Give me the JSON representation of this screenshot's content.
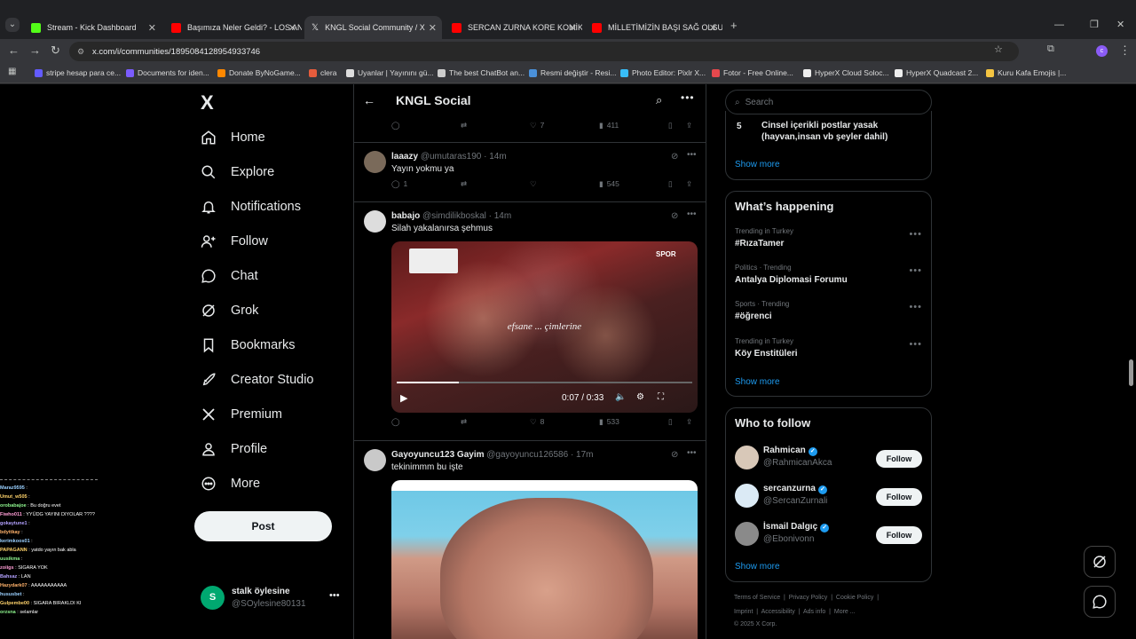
{
  "browser": {
    "tabs": [
      {
        "title": "Stream - Kick Dashboard",
        "color": "#53fc18"
      },
      {
        "title": "Başımıza Neler Geldi? - LOS AN",
        "color": "#ff0000"
      },
      {
        "title": "KNGL Social Community / X",
        "color": "#ffffff"
      },
      {
        "title": "SERCAN ZURNA KORE KOMİK",
        "color": "#ff0000"
      },
      {
        "title": "MİLLETİMİZİN BAŞI SAĞ OLSUN",
        "color": "#ff0000"
      }
    ],
    "url": "x.com/i/communities/1895084128954933746",
    "bookmarks": [
      "stripe hesap para ce...",
      "Documents for iden...",
      "Donate ByNoGame...",
      "clera",
      "Uyanlar | Yayınını gü...",
      "The best ChatBot an...",
      "Resmi değiştir - Resi...",
      "Photo Editor: Pixlr X...",
      "Fotor - Free Online...",
      "HyperX Cloud Soloc...",
      "HyperX Quadcast 2...",
      "Kuru Kafa Emojis |..."
    ]
  },
  "sidebar": {
    "logo": "X",
    "items": [
      {
        "label": "Home",
        "icon": "home-icon"
      },
      {
        "label": "Explore",
        "icon": "search-icon"
      },
      {
        "label": "Notifications",
        "icon": "bell-icon"
      },
      {
        "label": "Follow",
        "icon": "add-user-icon"
      },
      {
        "label": "Chat",
        "icon": "chat-icon"
      },
      {
        "label": "Grok",
        "icon": "grok-icon"
      },
      {
        "label": "Bookmarks",
        "icon": "bookmark-icon"
      },
      {
        "label": "Creator Studio",
        "icon": "rocket-icon"
      },
      {
        "label": "Premium",
        "icon": "x-icon"
      },
      {
        "label": "Profile",
        "icon": "person-icon"
      },
      {
        "label": "More",
        "icon": "more-circle-icon"
      }
    ],
    "post_label": "Post",
    "account": {
      "name": "stalk öylesine",
      "handle": "@SOylesine80131",
      "initial": "S"
    }
  },
  "header": {
    "title": "KNGL Social"
  },
  "feed": {
    "top_actions": {
      "likes": "7",
      "views": "411"
    },
    "posts": [
      {
        "name": "laaazy",
        "handle": "@umutaras190 · 14m",
        "text": "Yayın yokmu ya",
        "replies": "1",
        "likes": "",
        "views": "545"
      },
      {
        "name": "babajo",
        "handle": "@simdilikboskal · 14m",
        "text": "Silah yakalanırsa şehmus",
        "video_overlay": "efsane ... çimlerine",
        "video_time": "0:07 / 0:33",
        "watermark": "SPOR",
        "likes": "8",
        "views": "533"
      },
      {
        "name": "Gayoyuncu123 Gayim",
        "handle": "@gayoyuncu126586 · 17m",
        "text": "tekinimmm bu işte"
      }
    ]
  },
  "right": {
    "search_placeholder": "Search",
    "rule": {
      "num": "5",
      "text": "Cinsel içerikli postlar yasak (hayvan,insan vb şeyler dahil)"
    },
    "show_more": "Show more",
    "happening_title": "What’s happening",
    "trends": [
      {
        "meta": "Trending in Turkey",
        "name": "#RızaTamer"
      },
      {
        "meta": "Politics · Trending",
        "name": "Antalya Diplomasi Forumu"
      },
      {
        "meta": "Sports · Trending",
        "name": "#öğrenci"
      },
      {
        "meta": "Trending in Turkey",
        "name": "Köy Enstitüleri"
      }
    ],
    "who_title": "Who to follow",
    "follow_label": "Follow",
    "who": [
      {
        "name": "Rahmican",
        "handle": "@RahmicanAkca"
      },
      {
        "name": "sercanzurna",
        "handle": "@SercanZurnali"
      },
      {
        "name": "İsmail Dalgıç",
        "handle": "@Ebonivonn"
      }
    ],
    "footer": [
      "Terms of Service",
      "Privacy Policy",
      "Cookie Policy",
      "Imprint",
      "Accessibility",
      "Ads info",
      "More ...",
      "© 2025 X Corp."
    ]
  },
  "chat_overlay": [
    {
      "user": "Maraz9595",
      "msg": ""
    },
    {
      "user": "Umut_w505",
      "msg": ""
    },
    {
      "user": "orobabajoe",
      "msg": "Bu doğru evet"
    },
    {
      "user": "Fiwho011",
      "msg": "YYÜDG YAYINI DIYOLAR ????"
    },
    {
      "user": "gokaytune1",
      "msg": ""
    },
    {
      "user": "bdyttkay",
      "msg": ""
    },
    {
      "user": "kerimkoos01",
      "msg": ""
    },
    {
      "user": "PAPAGANN",
      "msg": "yatdo yayın bak abla"
    },
    {
      "user": "uusikma",
      "msg": ""
    },
    {
      "user": "zoiigs",
      "msg": "SIGARA YOK"
    },
    {
      "user": "Bahsaz",
      "msg": "LAN"
    },
    {
      "user": "Hazydark07",
      "msg": "AAAAAAAAAAA"
    },
    {
      "user": "hususbet",
      "msg": ""
    },
    {
      "user": "Gulpembe00",
      "msg": "SIGARA BIRAKLDI KI"
    },
    {
      "user": "orzsna",
      "msg": "selamlar"
    }
  ]
}
